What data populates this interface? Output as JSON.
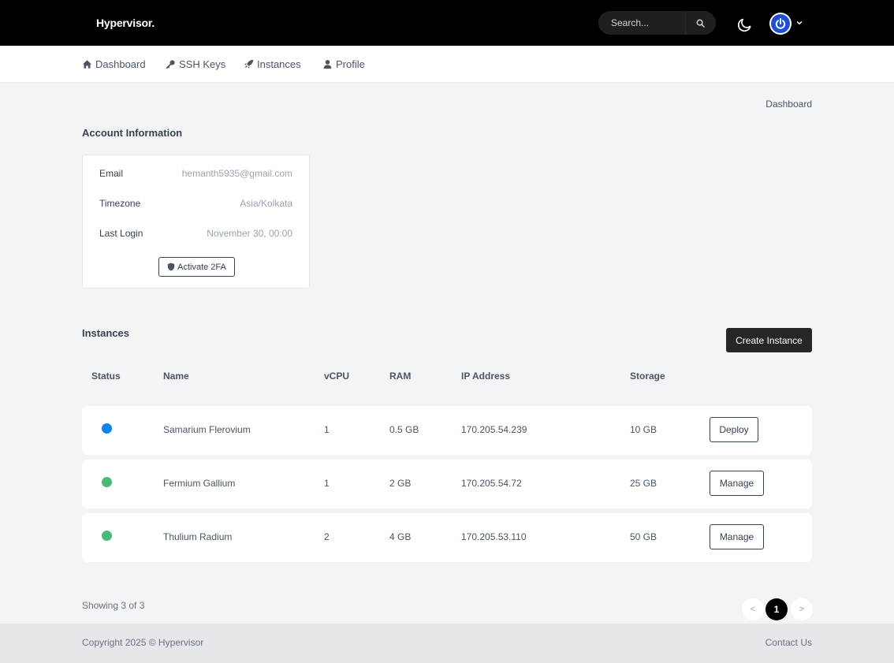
{
  "app": {
    "brand": "Hypervisor."
  },
  "header": {
    "search_placeholder": "Search...",
    "icons": {
      "search": "search-icon",
      "theme": "moon-icon",
      "avatar": "power-icon",
      "menu": "chevron-down-icon"
    }
  },
  "nav": {
    "items": [
      {
        "label": "Dashboard",
        "icon": "home-icon"
      },
      {
        "label": "SSH Keys",
        "icon": "key-icon"
      },
      {
        "label": "Instances",
        "icon": "rocket-icon"
      },
      {
        "label": "Profile",
        "icon": "user-icon"
      }
    ]
  },
  "breadcrumb": "Dashboard",
  "account": {
    "title": "Account Information",
    "rows": [
      {
        "label": "Email",
        "value": "hemanth5935@gmail.com"
      },
      {
        "label": "Timezone",
        "value": "Asia/Kolkata"
      },
      {
        "label": "Last Login",
        "value": "November 30, 00:00"
      }
    ],
    "activate_2fa": "Activate 2FA"
  },
  "instances": {
    "title": "Instances",
    "create_button": "Create Instance",
    "columns": [
      "Status",
      "Name",
      "vCPU",
      "RAM",
      "IP Address",
      "Storage"
    ],
    "rows": [
      {
        "status_color": "#0a84f0",
        "name": "Samarium Flerovium",
        "vcpu": "1",
        "ram": "0.5 GB",
        "ip": "170.205.54.239",
        "storage": "10 GB",
        "action": "Deploy"
      },
      {
        "status_color": "#48bb78",
        "name": "Fermium Gallium",
        "vcpu": "1",
        "ram": "2 GB",
        "ip": "170.205.54.72",
        "storage": "25 GB",
        "action": "Manage"
      },
      {
        "status_color": "#48bb78",
        "name": "Thulium Radium",
        "vcpu": "2",
        "ram": "4 GB",
        "ip": "170.205.53.110",
        "storage": "50 GB",
        "action": "Manage"
      }
    ],
    "showing": "Showing 3 of 3"
  },
  "pagination": {
    "prev": "<",
    "current": "1",
    "next": ">"
  },
  "footer": {
    "copyright": "Copyright 2025 © Hypervisor",
    "contact": "Contact Us"
  }
}
